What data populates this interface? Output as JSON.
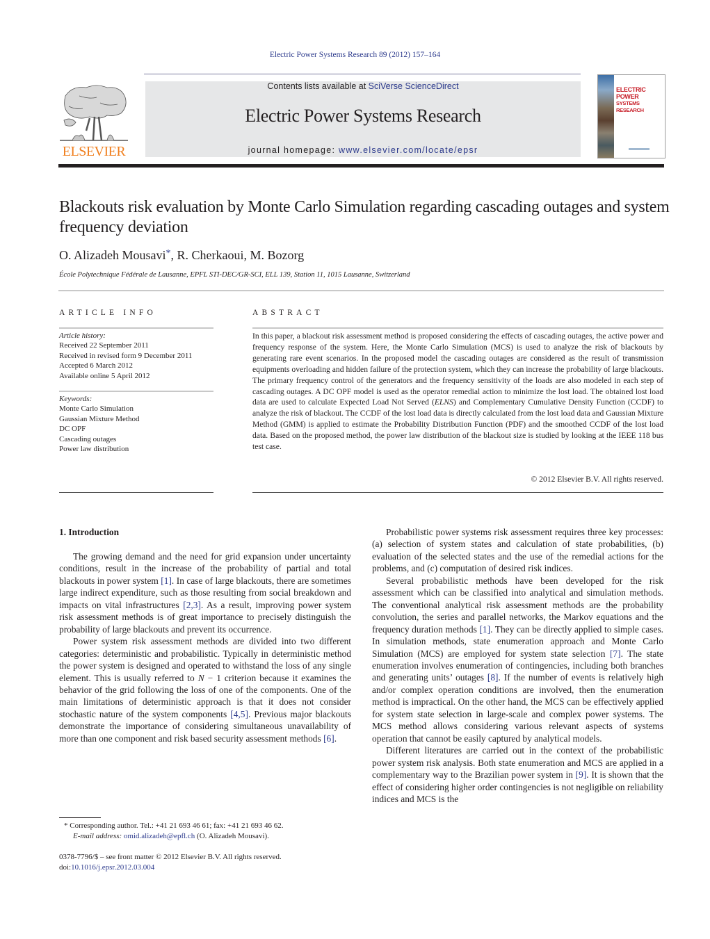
{
  "header": {
    "journal_ref": "Electric Power Systems Research 89 (2012) 157–164",
    "contents_prefix": "Contents lists available at ",
    "contents_link": "SciVerse ScienceDirect",
    "journal_name": "Electric Power Systems Research",
    "homepage_prefix": "journal homepage: ",
    "homepage_link": "www.elsevier.com/locate/epsr",
    "publisher_logo_text": "ELSEVIER",
    "cover_title_line1": "ELECTRIC POWER",
    "cover_title_line2": "SYSTEMS RESEARCH",
    "publisher_color": "#f07f1e",
    "link_color": "#2c3a8c",
    "cover_title_color": "#c8202a"
  },
  "article": {
    "title": "Blackouts risk evaluation by Monte Carlo Simulation regarding cascading outages and system frequency deviation",
    "authors": [
      {
        "name": "O. Alizadeh Mousavi",
        "marker": "*",
        "sep": ", "
      },
      {
        "name": "R. Cherkaoui",
        "sep": ", "
      },
      {
        "name": "M. Bozorg",
        "sep": ""
      }
    ],
    "affiliation": "École Polytechnique Fédérale de Lausanne, EPFL STI-DEC/GR-SCI, ELL 139, Station 11, 1015 Lausanne, Switzerland"
  },
  "article_info": {
    "heading": "ARTICLE INFO",
    "history_label": "Article history:",
    "history": [
      "Received 22 September 2011",
      "Received in revised form 9 December 2011",
      "Accepted 6 March 2012",
      "Available online 5 April 2012"
    ],
    "keywords_label": "Keywords:",
    "keywords": [
      "Monte Carlo Simulation",
      "Gaussian Mixture Method",
      "DC OPF",
      "Cascading outages",
      "Power law distribution"
    ]
  },
  "abstract": {
    "heading": "ABSTRACT",
    "part1": "In this paper, a blackout risk assessment method is proposed considering the effects of cascading outages, the active power and frequency response of the system. Here, the Monte Carlo Simulation (MCS) is used to analyze the risk of blackouts by generating rare event scenarios. In the proposed model the cascading outages are considered as the result of transmission equipments overloading and hidden failure of the protection system, which they can increase the probability of large blackouts. The primary frequency control of the generators and the frequency sensitivity of the loads are also modeled in each step of cascading outages. A DC OPF model is used as the operator remedial action to minimize the lost load. The obtained lost load data are used to calculate Expected Load Not Served (",
    "italic": "ELNS",
    "part2": ") and Complementary Cumulative Density Function (CCDF) to analyze the risk of blackout. The CCDF of the lost load data is directly calculated from the lost load data and Gaussian Mixture Method (GMM) is applied to estimate the Probability Distribution Function (PDF) and the smoothed CCDF of the lost load data. Based on the proposed method, the power law distribution of the blackout size is studied by looking at the IEEE 118 bus test case.",
    "copyright": "© 2012 Elsevier B.V. All rights reserved."
  },
  "body": {
    "section1_heading": "1.  Introduction",
    "left_p1": [
      {
        "t": "The growing demand and the need for grid expansion under uncertainty conditions, result in the increase of the probability of partial and total blackouts in power system "
      },
      {
        "ref": "[1]"
      },
      {
        "t": ". In case of large blackouts, there are sometimes large indirect expenditure, such as those resulting from social breakdown and impacts on vital infrastructures "
      },
      {
        "ref": "[2,3]"
      },
      {
        "t": ". As a result, improving power system risk assessment methods is of great importance to precisely distinguish the probability of large blackouts and prevent its occurrence."
      }
    ],
    "left_p2": [
      {
        "t": "Power system risk assessment methods are divided into two different categories: deterministic and probabilistic. Typically in deterministic method the power system is designed and operated to withstand the loss of any single element. This is usually referred to "
      },
      {
        "i": "N"
      },
      {
        "t": " − 1 criterion because it examines the behavior of the grid following the loss of one of the components. One of the main limitations of deterministic approach is that it does not consider stochastic nature of the system components "
      },
      {
        "ref": "[4,5]"
      },
      {
        "t": ". Previous major blackouts demonstrate the importance of considering simultaneous unavailability of more than one component and risk based security assessment methods "
      },
      {
        "ref": "[6]"
      },
      {
        "t": "."
      }
    ],
    "right_p1": [
      {
        "t": "Probabilistic power systems risk assessment requires three key processes: (a) selection of system states and calculation of state probabilities, (b) evaluation of the selected states and the use of the remedial actions for the problems, and (c) computation of desired risk indices."
      }
    ],
    "right_p2": [
      {
        "t": "Several probabilistic methods have been developed for the risk assessment which can be classified into analytical and simulation methods. The conventional analytical risk assessment methods are the probability convolution, the series and parallel networks, the Markov equations and the frequency duration methods "
      },
      {
        "ref": "[1]"
      },
      {
        "t": ". They can be directly applied to simple cases. In simulation methods, state enumeration approach and Monte Carlo Simulation (MCS) are employed for system state selection "
      },
      {
        "ref": "[7]"
      },
      {
        "t": ". The state enumeration involves enumeration of contingencies, including both branches and generating units’ outages "
      },
      {
        "ref": "[8]"
      },
      {
        "t": ". If the number of events is relatively high and/or complex operation conditions are involved, then the enumeration method is impractical. On the other hand, the MCS can be effectively applied for system state selection in large-scale and complex power systems. The MCS method allows considering various relevant aspects of systems operation that cannot be easily captured by analytical models."
      }
    ],
    "right_p3": [
      {
        "t": "Different literatures are carried out in the context of the probabilistic power system risk analysis. Both state enumeration and MCS are applied in a complementary way to the Brazilian power system in "
      },
      {
        "ref": "[9]"
      },
      {
        "t": ". It is shown that the effect of considering higher order contingencies is not negligible on reliability indices and MCS is the"
      }
    ]
  },
  "footnote": {
    "marker": "*",
    "text": " Corresponding author. Tel.: +41 21 693 46 61; fax: +41 21 693 46 62.",
    "email_label": "E-mail address: ",
    "email": "omid.alizadeh@epfl.ch",
    "email_suffix": " (O. Alizadeh Mousavi)."
  },
  "front_matter": {
    "issn_line": "0378-7796/$ – see front matter © 2012 Elsevier B.V. All rights reserved.",
    "doi_prefix": "doi:",
    "doi": "10.1016/j.epsr.2012.03.004"
  }
}
